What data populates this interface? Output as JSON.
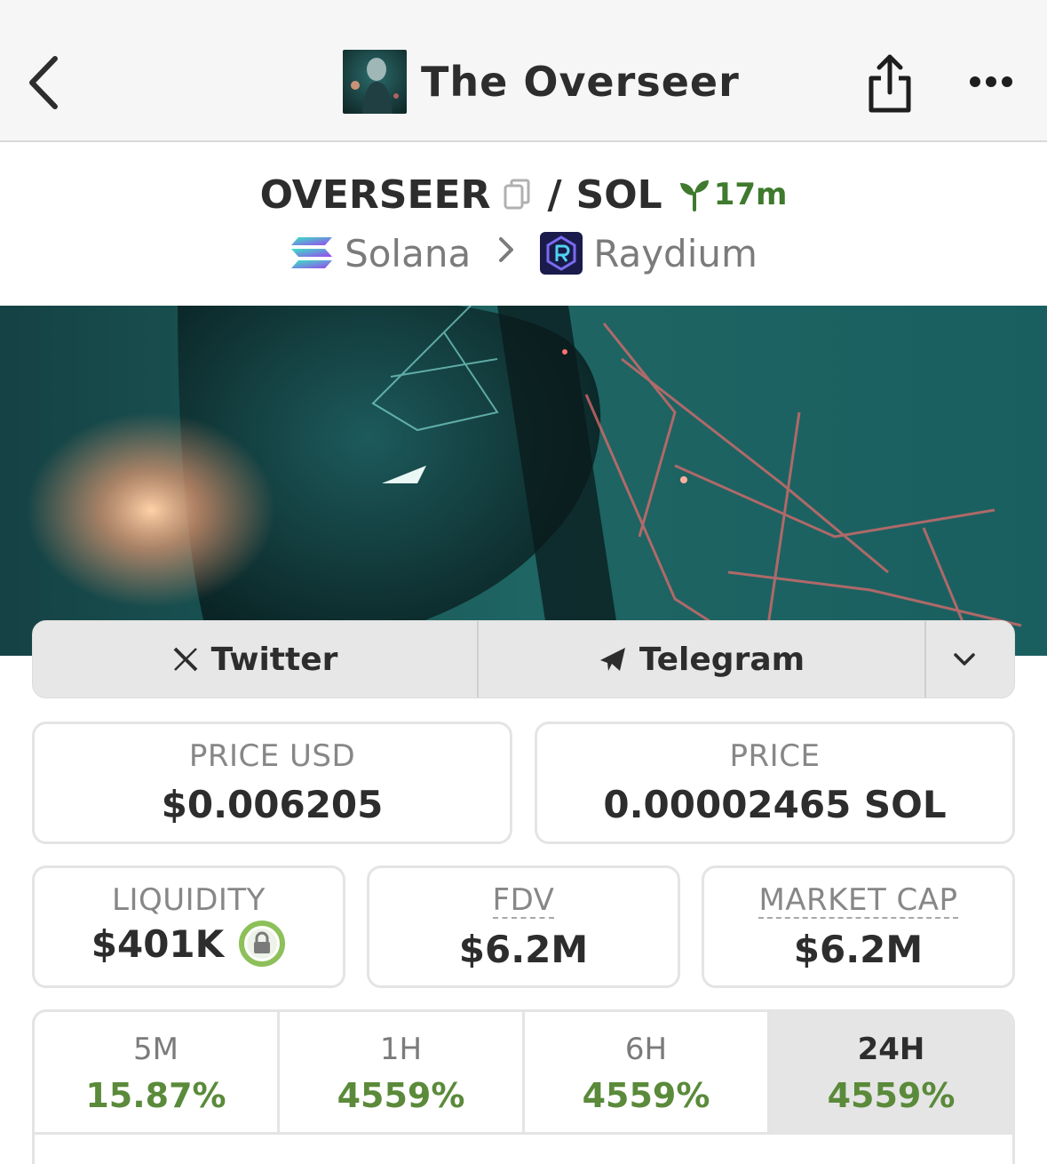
{
  "header": {
    "title": "The Overseer"
  },
  "pair": {
    "base": "OVERSEER",
    "separator": "/",
    "quote": "SOL",
    "age": "17m",
    "chain": "Solana",
    "dex": "Raydium"
  },
  "socials": {
    "twitter_label": "Twitter",
    "telegram_label": "Telegram"
  },
  "stats": {
    "price_usd": {
      "label": "PRICE USD",
      "value": "$0.006205"
    },
    "price_native": {
      "label": "PRICE",
      "value": "0.00002465 SOL"
    },
    "liquidity": {
      "label": "LIQUIDITY",
      "value": "$401K"
    },
    "fdv": {
      "label": "FDV",
      "value": "$6.2M"
    },
    "market_cap": {
      "label": "MARKET CAP",
      "value": "$6.2M"
    }
  },
  "changes": [
    {
      "label": "5M",
      "value": "15.87%"
    },
    {
      "label": "1H",
      "value": "4559%"
    },
    {
      "label": "6H",
      "value": "4559%"
    },
    {
      "label": "24H",
      "value": "4559%"
    }
  ],
  "colors": {
    "positive": "#5a8a3a",
    "age_green": "#3f7a2e",
    "lock_ring": "#8dc05a"
  }
}
